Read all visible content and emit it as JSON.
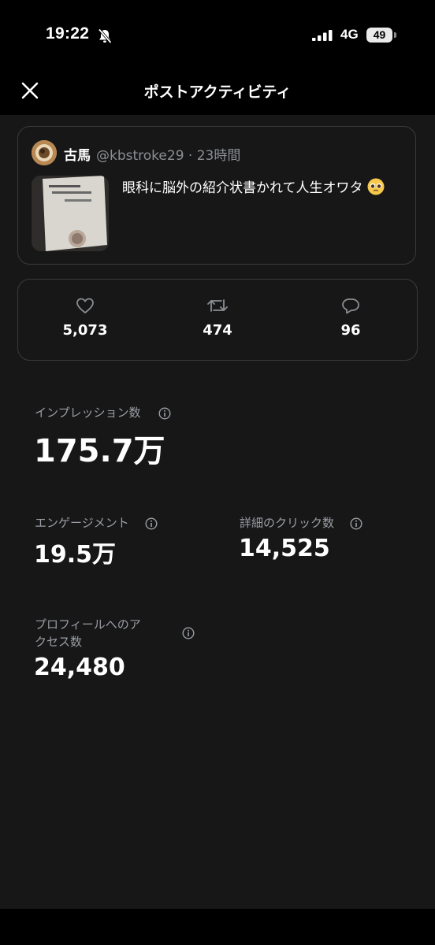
{
  "status_bar": {
    "time": "19:22",
    "network": "4G",
    "battery": "49"
  },
  "header": {
    "title": "ポストアクティビティ"
  },
  "tweet": {
    "author_name": "古馬",
    "author_meta": "@kbstroke29 · 23時間",
    "text": "眼科に脳外の紹介状書かれて人生オワタ",
    "emoji": "pleading-face-emoji"
  },
  "engagement": {
    "likes": "5,073",
    "reposts": "474",
    "replies": "96"
  },
  "metrics": {
    "impressions_label": "インプレッション数",
    "impressions_value": "175.7万",
    "engagements_label": "エンゲージメント",
    "engagements_value": "19.5万",
    "detail_clicks_label": "詳細のクリック数",
    "detail_clicks_value": "14,525",
    "profile_visits_label_line1": "プロフィールへのア",
    "profile_visits_label_line2": "クセス数",
    "profile_visits_value": "24,480"
  },
  "colors": {
    "background": "#171718",
    "border": "#3a3b3d",
    "secondary_text": "#8b8f93"
  }
}
